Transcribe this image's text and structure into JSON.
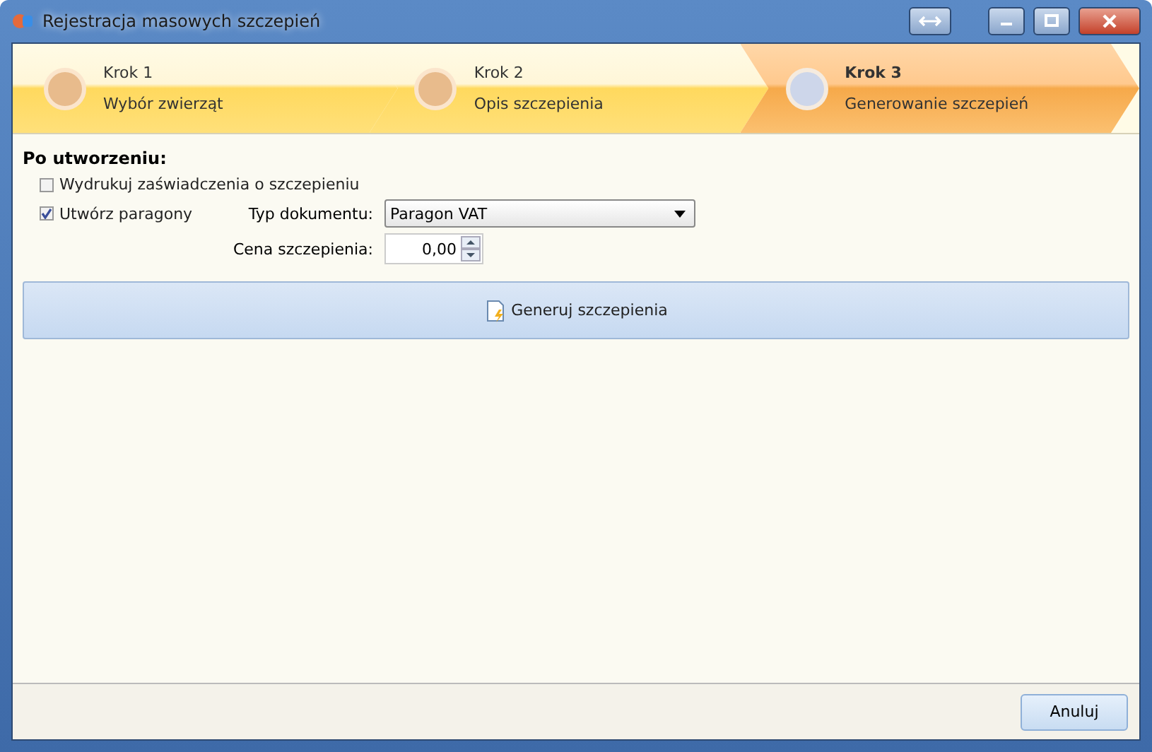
{
  "window": {
    "title": "Rejestracja masowych szczepień"
  },
  "steps": [
    {
      "title": "Krok 1",
      "subtitle": "Wybór zwierząt",
      "selected": false
    },
    {
      "title": "Krok 2",
      "subtitle": "Opis szczepienia",
      "selected": false
    },
    {
      "title": "Krok 3",
      "subtitle": "Generowanie szczepień",
      "selected": true
    }
  ],
  "section": {
    "title": "Po utworzeniu:"
  },
  "options": [
    {
      "label": "Wydrukuj zaświadczenia o szczepieniu",
      "checked": false
    },
    {
      "label": "Utwórz paragony",
      "checked": true
    }
  ],
  "document_type": {
    "label": "Typ dokumentu:",
    "value": "Paragon VAT"
  },
  "price": {
    "label": "Cena szczepienia:",
    "value": "0,00"
  },
  "generate_button": "Generuj szczepienia",
  "cancel_button": "Anuluj"
}
